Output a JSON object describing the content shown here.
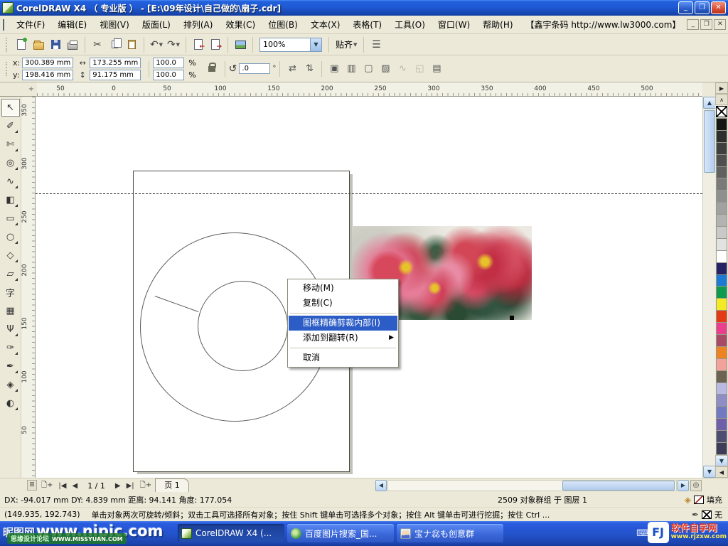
{
  "window": {
    "title": "CorelDRAW X4 （ 专业版 ） - [E:\\09年设计\\自己做的\\扇子.cdr]",
    "controls": {
      "minimize": "_",
      "maximize": "❐",
      "close": "✕"
    }
  },
  "menu": {
    "items": [
      "文件(F)",
      "编辑(E)",
      "视图(V)",
      "版面(L)",
      "排列(A)",
      "效果(C)",
      "位图(B)",
      "文本(X)",
      "表格(T)",
      "工具(O)",
      "窗口(W)",
      "帮助(H)",
      "【鑫宇条码 http://www.lw3000.com】"
    ]
  },
  "toolbar": {
    "zoom_value": "100%",
    "snap_label": "贴齐",
    "icon_groups": [
      [
        "new",
        "open",
        "save",
        "print"
      ],
      [
        "cut",
        "copy",
        "paste"
      ],
      [
        "undo",
        "redo"
      ],
      [
        "import",
        "export"
      ],
      [
        "application-launcher"
      ]
    ]
  },
  "property_bar": {
    "x_label": "x:",
    "x_value": "300.389 mm",
    "y_label": "y:",
    "y_value": "198.416 mm",
    "width_value": "173.255 mm",
    "height_value": "91.175 mm",
    "scale_h": "100.0",
    "scale_v": "100.0",
    "percent_h": "%",
    "percent_v": "%",
    "rotation_value": ".0",
    "degree_symbol": "°",
    "transform_buttons": [
      {
        "name": "mirror-horizontal-button",
        "glyph": "⇄"
      },
      {
        "name": "mirror-vertical-button",
        "glyph": "⇅"
      }
    ],
    "object_buttons": [
      {
        "name": "combine-button",
        "glyph": "▣",
        "disabled": false
      },
      {
        "name": "group-button",
        "glyph": "▥",
        "disabled": false
      },
      {
        "name": "ungroup-button",
        "glyph": "▢",
        "disabled": false
      },
      {
        "name": "ungroup-all-button",
        "glyph": "▨",
        "disabled": false
      },
      {
        "name": "convert-to-curves-button",
        "glyph": "∿",
        "disabled": true
      },
      {
        "name": "close-path-button",
        "glyph": "◱",
        "disabled": true
      },
      {
        "name": "quick-customize-button",
        "glyph": "▤",
        "disabled": false
      }
    ]
  },
  "rulers": {
    "horizontal": [
      "50",
      "0",
      "50",
      "100",
      "150",
      "200",
      "250",
      "300",
      "350",
      "400",
      "450",
      "500"
    ],
    "vertical": [
      "350",
      "300",
      "250",
      "200",
      "150",
      "100",
      "50"
    ]
  },
  "toolbox": {
    "tools": [
      {
        "name": "pick-tool",
        "glyph": "↖",
        "selected": true,
        "flyout": false
      },
      {
        "name": "shape-tool",
        "glyph": "✐",
        "selected": false,
        "flyout": true
      },
      {
        "name": "crop-tool",
        "glyph": "✄",
        "selected": false,
        "flyout": true
      },
      {
        "name": "zoom-tool",
        "glyph": "◎",
        "selected": false,
        "flyout": true
      },
      {
        "name": "freehand-tool",
        "glyph": "∿",
        "selected": false,
        "flyout": true
      },
      {
        "name": "smart-fill-tool",
        "glyph": "◧",
        "selected": false,
        "flyout": true
      },
      {
        "name": "rectangle-tool",
        "glyph": "▭",
        "selected": false,
        "flyout": true
      },
      {
        "name": "ellipse-tool",
        "glyph": "○",
        "selected": false,
        "flyout": true
      },
      {
        "name": "polygon-tool",
        "glyph": "◇",
        "selected": false,
        "flyout": true
      },
      {
        "name": "basic-shapes-tool",
        "glyph": "▱",
        "selected": false,
        "flyout": true
      },
      {
        "name": "text-tool",
        "glyph": "字",
        "selected": false,
        "flyout": false
      },
      {
        "name": "table-tool",
        "glyph": "▦",
        "selected": false,
        "flyout": false
      },
      {
        "name": "interactive-blend-tool",
        "glyph": "Ψ",
        "selected": false,
        "flyout": true
      },
      {
        "name": "eyedropper-tool",
        "glyph": "✑",
        "selected": false,
        "flyout": true
      },
      {
        "name": "outline-pen-tool",
        "glyph": "✒",
        "selected": false,
        "flyout": true
      },
      {
        "name": "fill-tool",
        "glyph": "◈",
        "selected": false,
        "flyout": true
      },
      {
        "name": "interactive-fill-tool",
        "glyph": "◐",
        "selected": false,
        "flyout": true
      }
    ]
  },
  "context_menu": {
    "items": [
      {
        "label": "移动(M)",
        "highlighted": false,
        "submenu": false
      },
      {
        "label": "复制(C)",
        "highlighted": false,
        "submenu": false
      },
      {
        "separator": true
      },
      {
        "label": "图框精确剪裁内部(I)",
        "highlighted": true,
        "submenu": false
      },
      {
        "label": "添加到翻转(R)",
        "highlighted": false,
        "submenu": true
      },
      {
        "separator": true
      },
      {
        "label": "取消",
        "highlighted": false,
        "submenu": false
      }
    ],
    "highlight_color": "#2c5cc5"
  },
  "page_nav": {
    "page_indicator": "1 / 1",
    "page_tab": "页 1"
  },
  "status_bar": {
    "metrics": "DX: -94.017 mm DY: 4.839 mm 距离: 94.141 角度: 177.054",
    "object_info": "2509 对象群组 于 图层 1",
    "fill_label": "填充",
    "cursor_pos": "(149.935, 192.743)",
    "hint": "单击对象两次可旋转/倾斜；双击工具可选择所有对象；按住 Shift 键单击可选择多个对象；按住 Alt 键单击可进行挖掘；按住 Ctrl ...",
    "outline_label": "无"
  },
  "taskbar": {
    "watermark_site": "昵图网",
    "watermark_url": "www.nipic.com",
    "watermark_forum": "思缘设计论坛",
    "watermark_forum_url": "WWW.MISSYUAN.COM",
    "buttons": [
      {
        "label": "CorelDRAW X4 (...",
        "icon": "coreldraw",
        "active": true
      },
      {
        "label": "百度图片搜索_国...",
        "icon": "baidu",
        "active": false
      },
      {
        "label": "宝ナ惢も创意群",
        "icon": "qq",
        "active": false
      }
    ],
    "tray_keyboard_icon": "⌨",
    "logo_initials": "FJ",
    "logo_title": "软件自学网",
    "logo_url": "www.rjzxw.com"
  },
  "palette": {
    "none_label": "no-color",
    "colors": [
      "#151515",
      "#2e2e2e",
      "#3f3f3f",
      "#4f4f4f",
      "#616161",
      "#7a7a7a",
      "#8f8f8f",
      "#a1a1a1",
      "#b3b3b3",
      "#c9c9c9",
      "#e2e2e2",
      "#ffffff",
      "#262266",
      "#1d7bd3",
      "#109a50",
      "#f2ea25",
      "#e13a15",
      "#ec3e8e",
      "#a64a66",
      "#ee8324",
      "#f2a29b",
      "#6c6353",
      "#bab9e3",
      "#8e8dc6",
      "#7079c1",
      "#6e5fa9",
      "#4e4e72",
      "#3d3d5a"
    ]
  }
}
